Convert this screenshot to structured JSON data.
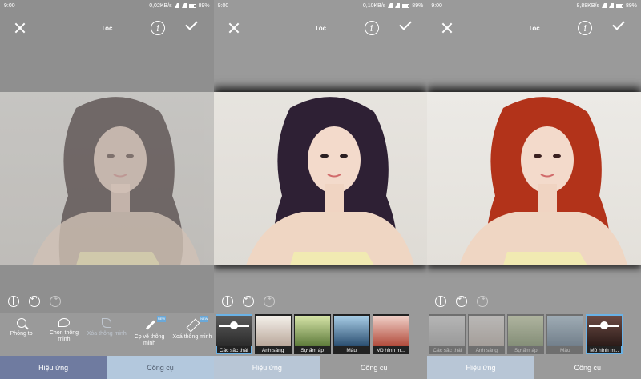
{
  "screens": [
    {
      "status": {
        "time": "9:00",
        "net": "0,02KB/s",
        "battery": "89%"
      },
      "title": "Tóc",
      "tools": [
        {
          "label": "Phóng to"
        },
        {
          "label": "Chọn thông minh"
        },
        {
          "label": "Xóa thông minh"
        },
        {
          "label": "Cọ vẽ thông minh",
          "badge": "NEW"
        },
        {
          "label": "Xoá thông minh",
          "badge": "NEW"
        }
      ],
      "nav": {
        "effects": "Hiệu ứng",
        "tools": "Công cụ"
      }
    },
    {
      "status": {
        "time": "9:00",
        "net": "0,10KB/s",
        "battery": "89%"
      },
      "title": "Tóc",
      "thumbs": [
        "Các sắc thái",
        "Ánh sáng",
        "Sự ấm áp",
        "Màu",
        "Mô hình m..."
      ],
      "nav": {
        "effects": "Hiệu ứng",
        "tools": "Công cụ"
      }
    },
    {
      "status": {
        "time": "9:00",
        "net": "8,88KB/s",
        "battery": "89%"
      },
      "title": "Tóc",
      "thumbs": [
        "Các sắc thái",
        "Ánh sáng",
        "Sự ấm áp",
        "Màu",
        "Mô hình m..."
      ],
      "nav": {
        "effects": "Hiệu ứng",
        "tools": "Công cụ"
      }
    }
  ],
  "colors": {
    "hair1": "#4a3c3c",
    "hair2": "#2e2034",
    "hair3": "#b2331a",
    "accent": "#6ab2e6"
  }
}
